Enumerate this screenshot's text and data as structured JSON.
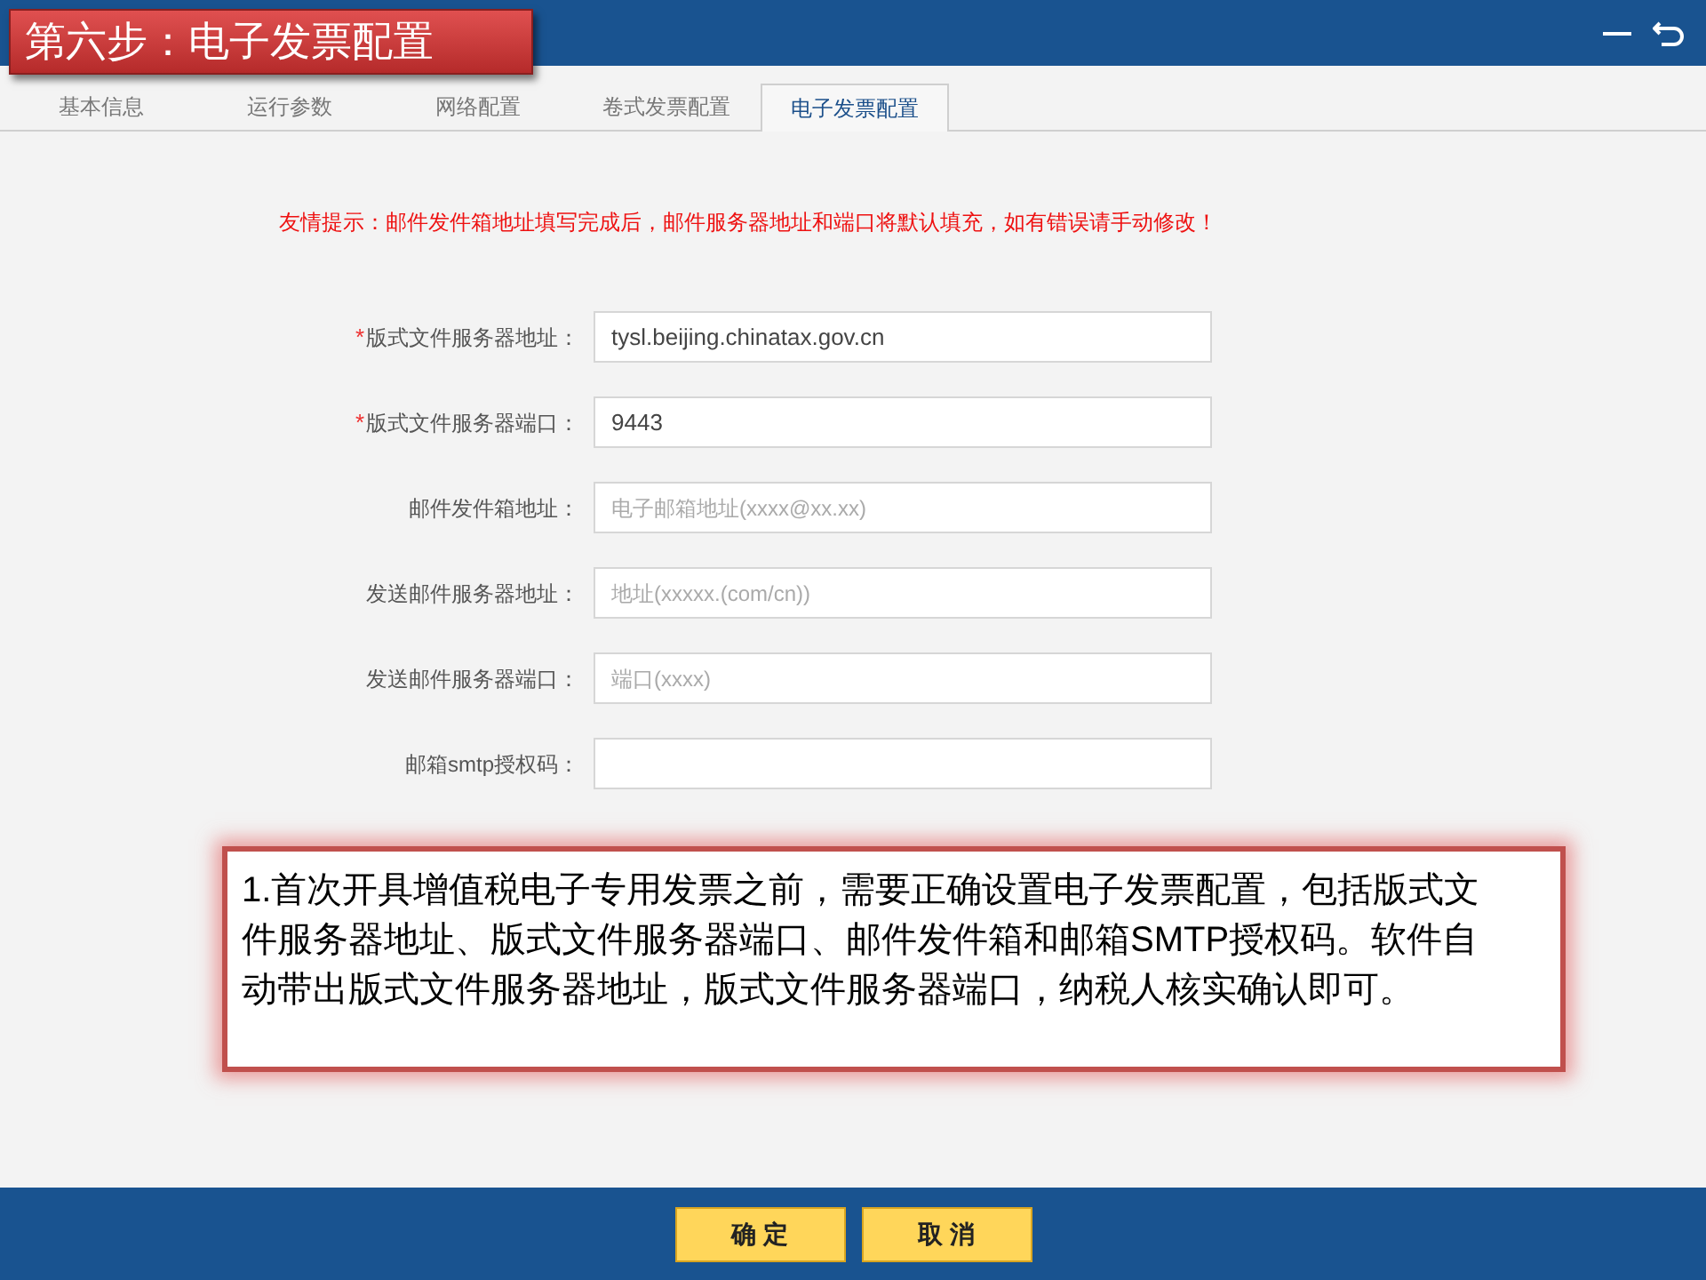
{
  "window": {
    "title": "第六步：电子发票配置"
  },
  "tabs": [
    {
      "label": "基本信息",
      "selected": false
    },
    {
      "label": "运行参数",
      "selected": false
    },
    {
      "label": "网络配置",
      "selected": false
    },
    {
      "label": "卷式发票配置",
      "selected": false
    },
    {
      "label": "电子发票配置",
      "selected": true
    }
  ],
  "hint": "友情提示：邮件发件箱地址填写完成后，邮件服务器地址和端口将默认填充，如有错误请手动修改！",
  "fields": [
    {
      "label": "版式文件服务器地址：",
      "marker": "*",
      "value": "tysl.beijing.chinatax.gov.cn"
    },
    {
      "label": "版式文件服务器端口：",
      "marker": "*",
      "value": "9443"
    },
    {
      "label": "邮件发件箱地址：",
      "placeholder": "电子邮箱地址(xxxx@xx.xx)"
    },
    {
      "label": "发送邮件服务器地址：",
      "placeholder": "地址(xxxxx.(com/cn))"
    },
    {
      "label": "发送邮件服务器端口：",
      "placeholder": "端口(xxxx)"
    },
    {
      "label": "邮箱smtp授权码："
    }
  ],
  "callout": "1.首次开具增值税电子专用发票之前，需要正确设置电子发票配置，包括版式文件服务器地址、版式文件服务器端口、邮件发件箱和邮箱SMTP授权码。软件自动带出版式文件服务器地址，版式文件服务器端口，纳税人核实确认即可。",
  "buttons": [
    "确 定",
    "取 消"
  ]
}
